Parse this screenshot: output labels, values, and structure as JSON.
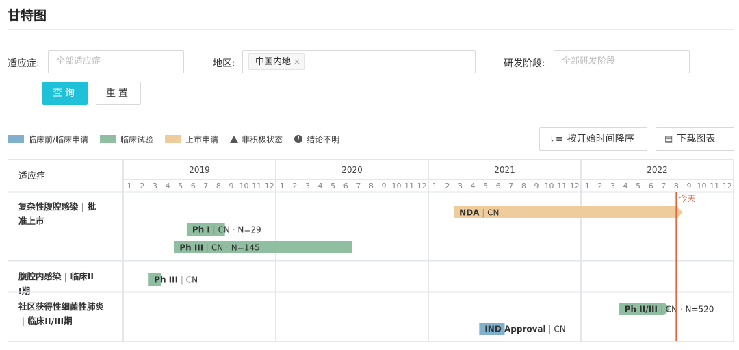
{
  "page": {
    "title": "甘特图"
  },
  "filters": {
    "indication": {
      "label": "适应症:",
      "placeholder": "全部适应症"
    },
    "region": {
      "label": "地区:",
      "tag": "中国内地",
      "tag_close": "×"
    },
    "phase": {
      "label": "研发阶段:",
      "placeholder": "全部研发阶段"
    },
    "query_label": "查询",
    "reset_label": "重置"
  },
  "legend": {
    "items": [
      {
        "label": "临床前/临床申请",
        "color": "#7fb0cc"
      },
      {
        "label": "临床试验",
        "color": "#8fbfa0"
      },
      {
        "label": "上市申请",
        "color": "#efcc9b"
      }
    ],
    "inactive_label": "非积极状态",
    "inactive_icon": "triangle-icon",
    "unclear_label": "结论不明",
    "unclear_icon": "exclamation-circle-icon"
  },
  "toolbar": {
    "sort_label": "按开始时间降序",
    "sort_icon": "sort-descending-icon",
    "download_label": "下载图表",
    "download_icon": "chart-download-icon"
  },
  "chart_data": {
    "type": "gantt",
    "row_header": "适应症",
    "years": [
      "2019",
      "2020",
      "2021",
      "2022"
    ],
    "months": [
      "1",
      "2",
      "3",
      "4",
      "5",
      "6",
      "7",
      "8",
      "9",
      "10",
      "11",
      "12"
    ],
    "today_label": "今天",
    "today": "2022-08",
    "colors": {
      "clinical_application": "#7fb0cc",
      "clinical_trial": "#8fbfa0",
      "market_application": "#efcc9b",
      "today_line": "#e0663e"
    },
    "rows": [
      {
        "label": "复杂性腹腔感染 | 批准上市",
        "bars": [
          {
            "stage": "NDA",
            "region": "CN",
            "n": "",
            "category": "market_application",
            "start": "2021-03",
            "end": "2022-08",
            "arrow": true
          },
          {
            "stage": "Ph I",
            "region": "CN",
            "n": "N=29",
            "category": "clinical_trial",
            "start": "2019-06",
            "end": "2019-08",
            "arrow": false
          },
          {
            "stage": "Ph III",
            "region": "CN",
            "n": "N=145",
            "category": "clinical_trial",
            "start": "2019-05",
            "end": "2020-06",
            "arrow": false
          }
        ]
      },
      {
        "label": "腹腔内感染 | 临床III期",
        "bars": [
          {
            "stage": "Ph III",
            "region": "CN",
            "n": "",
            "category": "clinical_trial",
            "start": "2019-03",
            "end": "2019-03",
            "arrow": false
          }
        ]
      },
      {
        "label": "社区获得性细菌性肺炎 | 临床II/III期",
        "bars": [
          {
            "stage": "Ph II/III",
            "region": "CN",
            "n": "N=520",
            "category": "clinical_trial",
            "start": "2022-04",
            "end": "2022-07",
            "arrow": true
          },
          {
            "stage": "IND Approval",
            "region": "CN",
            "n": "",
            "category": "clinical_application",
            "start": "2021-05",
            "end": "2021-06",
            "arrow": false
          }
        ]
      }
    ]
  }
}
